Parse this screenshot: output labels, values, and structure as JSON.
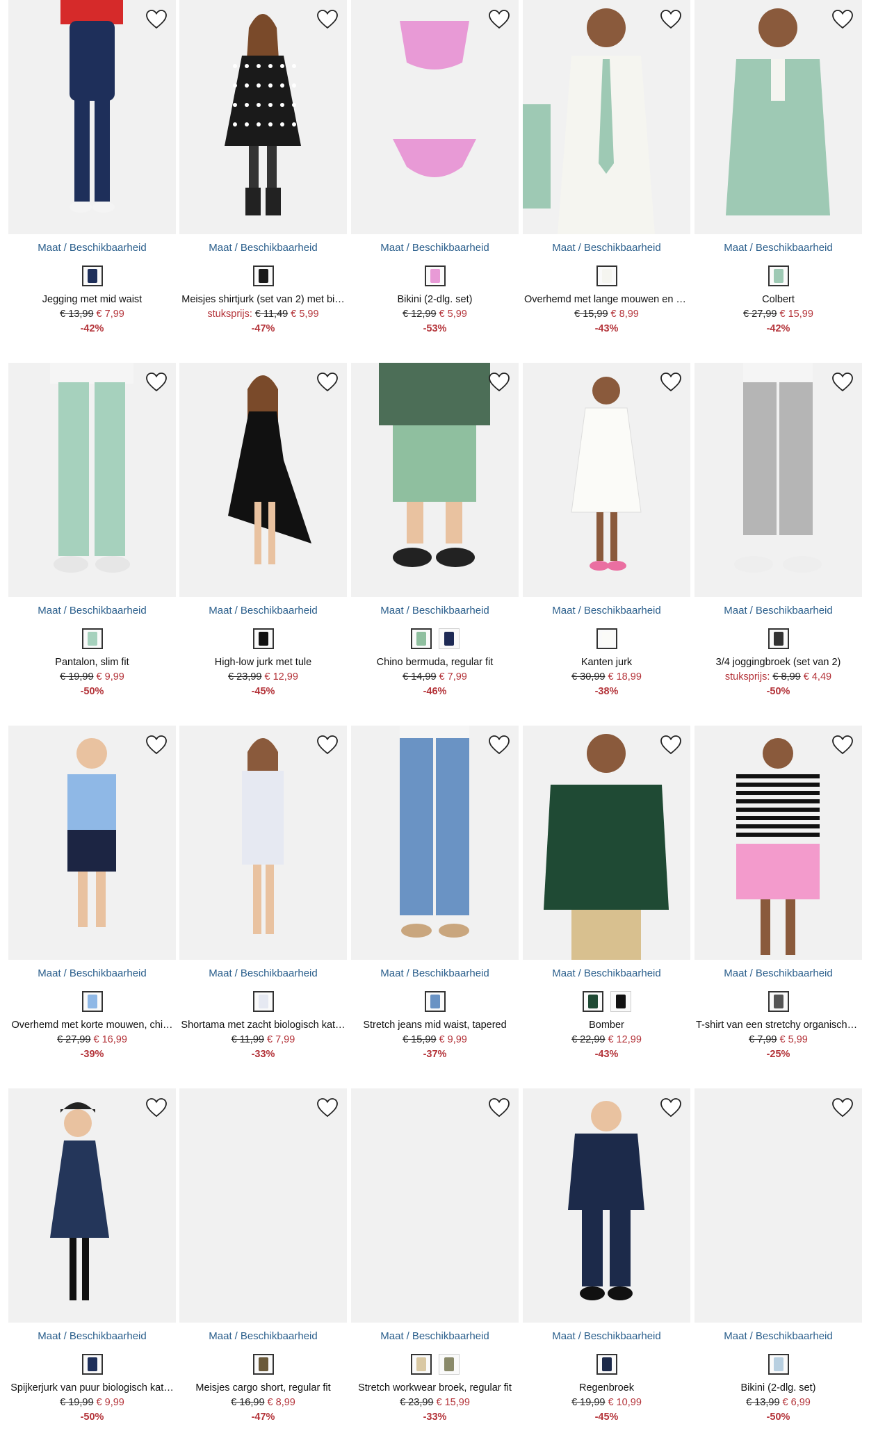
{
  "common": {
    "maat": "Maat",
    "separator": "/",
    "availability": "Beschikbaarheid"
  },
  "colors": {
    "link": "#2b5f8c",
    "sale": "#b4343a",
    "image_bg": "#f1f1f1"
  },
  "products": [
    {
      "name": "Jegging met mid waist",
      "price_label": "",
      "old_price": "€ 13,99",
      "new_price": "€ 7,99",
      "discount": "-42%",
      "icon": "heart-icon",
      "swatches": [
        "#1e2f5a"
      ],
      "illustration": "jeans-girl"
    },
    {
      "name": "Meisjes shirtjurk (set van 2) met bi…",
      "price_label": "stuksprijs:",
      "old_price": "€ 11,49",
      "new_price": "€ 5,99",
      "discount": "-47%",
      "icon": "heart-icon",
      "swatches": [
        "#1a1a1a"
      ],
      "illustration": "dots-dress"
    },
    {
      "name": "Bikini (2-dlg. set)",
      "price_label": "",
      "old_price": "€ 12,99",
      "new_price": "€ 5,99",
      "discount": "-53%",
      "icon": "heart-icon",
      "swatches": [
        "#e89ad6"
      ],
      "illustration": "bikini-pink"
    },
    {
      "name": "Overhemd met lange mouwen en st…",
      "price_label": "",
      "old_price": "€ 15,99",
      "new_price": "€ 8,99",
      "discount": "-43%",
      "icon": "heart-icon",
      "swatches": [
        "#f5f5f0"
      ],
      "illustration": "shirt-tie"
    },
    {
      "name": "Colbert",
      "price_label": "",
      "old_price": "€ 27,99",
      "new_price": "€ 15,99",
      "discount": "-42%",
      "icon": "heart-icon",
      "swatches": [
        "#9ec9b4"
      ],
      "illustration": "mint-blazer"
    },
    {
      "name": "Pantalon, slim fit",
      "price_label": "",
      "old_price": "€ 19,99",
      "new_price": "€ 9,99",
      "discount": "-50%",
      "icon": "heart-icon",
      "swatches": [
        "#a6d1bd"
      ],
      "illustration": "mint-pants"
    },
    {
      "name": "High-low jurk met tule",
      "price_label": "",
      "old_price": "€ 23,99",
      "new_price": "€ 12,99",
      "discount": "-45%",
      "icon": "heart-icon",
      "swatches": [
        "#111111"
      ],
      "illustration": "black-dress"
    },
    {
      "name": "Chino bermuda, regular fit",
      "price_label": "",
      "old_price": "€ 14,99",
      "new_price": "€ 7,99",
      "discount": "-46%",
      "icon": "heart-icon",
      "swatches": [
        "#8fbf9f",
        "#1e2a55"
      ],
      "illustration": "green-shorts"
    },
    {
      "name": "Kanten jurk",
      "price_label": "",
      "old_price": "€ 30,99",
      "new_price": "€ 18,99",
      "discount": "-38%",
      "icon": "heart-icon",
      "swatches": [
        "#fbfbf8"
      ],
      "illustration": "lace-dress"
    },
    {
      "name": "3/4 joggingbroek (set van 2)",
      "price_label": "stuksprijs:",
      "old_price": "€ 8,99",
      "new_price": "€ 4,49",
      "discount": "-50%",
      "icon": "heart-icon",
      "swatches": [
        "#333333"
      ],
      "illustration": "grey-joggers"
    },
    {
      "name": "Overhemd met korte mouwen, chi…",
      "price_label": "",
      "old_price": "€ 27,99",
      "new_price": "€ 16,99",
      "discount": "-39%",
      "icon": "heart-icon",
      "swatches": [
        "#8fb8e6"
      ],
      "illustration": "boy-bowtie"
    },
    {
      "name": "Shortama met zacht biologisch kat…",
      "price_label": "",
      "old_price": "€ 11,99",
      "new_price": "€ 7,99",
      "discount": "-33%",
      "icon": "heart-icon",
      "swatches": [
        "#e6e9f2"
      ],
      "illustration": "pajama"
    },
    {
      "name": "Stretch jeans mid waist, tapered",
      "price_label": "",
      "old_price": "€ 15,99",
      "new_price": "€ 9,99",
      "discount": "-37%",
      "icon": "heart-icon",
      "swatches": [
        "#6a93c4"
      ],
      "illustration": "light-jeans"
    },
    {
      "name": "Bomber",
      "price_label": "",
      "old_price": "€ 22,99",
      "new_price": "€ 12,99",
      "discount": "-43%",
      "icon": "heart-icon",
      "swatches": [
        "#1f4a34",
        "#111111"
      ],
      "illustration": "green-bomber"
    },
    {
      "name": "T-shirt van een stretchy organische …",
      "price_label": "",
      "old_price": "€ 7,99",
      "new_price": "€ 5,99",
      "discount": "-25%",
      "icon": "heart-icon",
      "swatches": [
        "#555555"
      ],
      "illustration": "stripe-tee"
    },
    {
      "name": "Spijkerjurk van puur biologisch kat…",
      "price_label": "",
      "old_price": "€ 19,99",
      "new_price": "€ 9,99",
      "discount": "-50%",
      "icon": "heart-icon",
      "swatches": [
        "#1e2f5a"
      ],
      "illustration": "denim-dress"
    },
    {
      "name": "Meisjes cargo short, regular fit",
      "price_label": "",
      "old_price": "€ 16,99",
      "new_price": "€ 8,99",
      "discount": "-47%",
      "icon": "heart-icon",
      "swatches": [
        "#6b5a3a"
      ],
      "illustration": "empty"
    },
    {
      "name": "Stretch workwear broek, regular fit",
      "price_label": "",
      "old_price": "€ 23,99",
      "new_price": "€ 15,99",
      "discount": "-33%",
      "icon": "heart-icon",
      "swatches": [
        "#d9c8a3",
        "#8a8a6a"
      ],
      "illustration": "empty"
    },
    {
      "name": "Regenbroek",
      "price_label": "",
      "old_price": "€ 19,99",
      "new_price": "€ 10,99",
      "discount": "-45%",
      "icon": "heart-icon",
      "swatches": [
        "#1c2a4a"
      ],
      "illustration": "rain-suit"
    },
    {
      "name": "Bikini (2-dlg. set)",
      "price_label": "",
      "old_price": "€ 13,99",
      "new_price": "€ 6,99",
      "discount": "-50%",
      "icon": "heart-icon",
      "swatches": [
        "#b8cfe0"
      ],
      "illustration": "empty"
    }
  ]
}
